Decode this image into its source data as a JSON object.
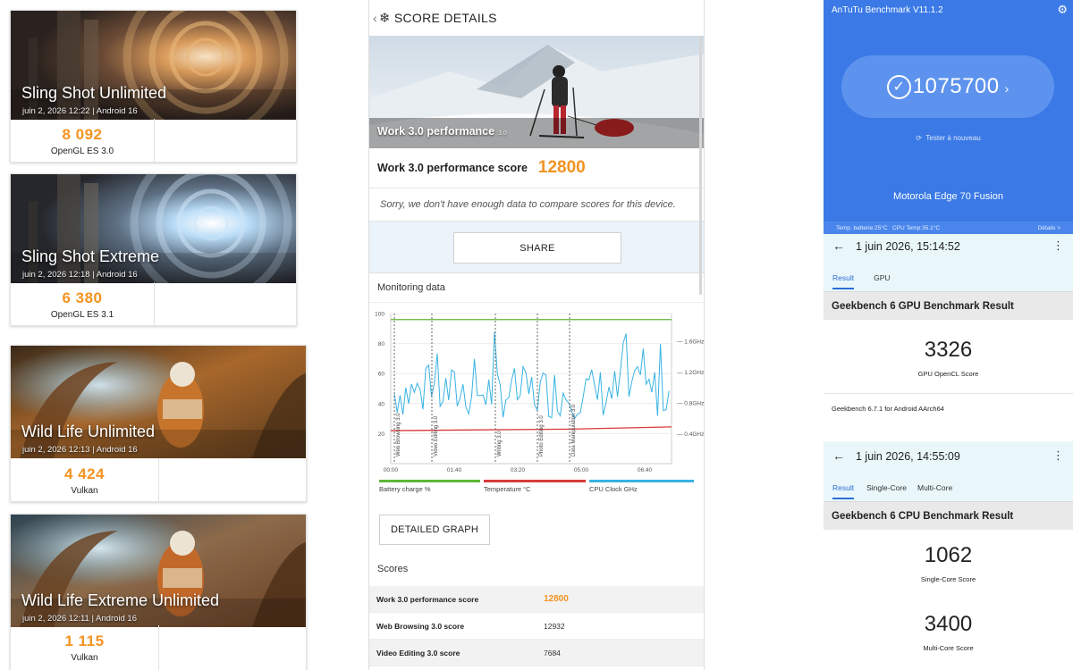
{
  "threedmark": {
    "cards": [
      {
        "title": "Sling Shot Unlimited",
        "subtitle": "juin 2, 2026 12:22 | Android 16",
        "score": "8 092",
        "api": "OpenGL ES 3.0"
      },
      {
        "title": "Sling Shot Extreme",
        "subtitle": "juin 2, 2026 12:18 | Android 16",
        "score": "6 380",
        "api": "OpenGL ES 3.1"
      },
      {
        "title": "Wild Life Unlimited",
        "subtitle": "juin 2, 2026 12:13 | Android 16",
        "score": "4 424",
        "api": "Vulkan"
      },
      {
        "title": "Wild Life Extreme Unlimited",
        "subtitle": "juin 2, 2026 12:11 | Android 16",
        "score": "1 115",
        "api": "Vulkan"
      }
    ]
  },
  "pcmark": {
    "back_icon": "chevron-left-icon",
    "header": "SCORE DETAILS",
    "hero_title": "Work 3.0 performance",
    "hero_version": "3.0",
    "score_label": "Work 3.0 performance score",
    "score_value": "12800",
    "sorry_text": "Sorry, we don't have enough data to compare scores for this device.",
    "share_label": "SHARE",
    "monitoring_title": "Monitoring data",
    "detailed_graph_label": "DETAILED GRAPH",
    "scores_title": "Scores",
    "scores_rows": [
      {
        "label": "Work 3.0 performance score",
        "value": "12800"
      },
      {
        "label": "Web Browsing 3.0 score",
        "value": "12932"
      },
      {
        "label": "Video Editing 3.0 score",
        "value": "7684"
      }
    ],
    "chart_data": {
      "type": "line",
      "x_ticks": [
        "00:00",
        "01:40",
        "03:20",
        "05:00",
        "06:40"
      ],
      "y_left_ticks": [
        "20",
        "40",
        "60",
        "80",
        "100"
      ],
      "y_right_ticks": [
        "0.4GHz",
        "0.8GHz",
        "1.2GHz",
        "1.6GHz"
      ],
      "ylim": [
        0,
        100
      ],
      "markers": [
        "Web Browsing 3.0",
        "Video Editing 3.0",
        "Writing 3.0",
        "Photo Editing 3.0",
        "Data Manipulation 3.0"
      ],
      "series": [
        {
          "name": "Battery charge %",
          "color": "#5fb636"
        },
        {
          "name": "Temperature °C",
          "color": "#d93a3a"
        },
        {
          "name": "CPU Clock GHz",
          "color": "#38b3e3"
        }
      ]
    }
  },
  "antutu": {
    "title": "AnTuTu Benchmark V11.1.2",
    "score": "1075700",
    "retest": "Tester à nouveau",
    "device": "Motorola Edge 70 Fusion",
    "battery_temp": "Temp. batterie:25°C",
    "cpu_temp": "CPU Temp:35.1°C",
    "details": "Détails >"
  },
  "geekbench_gpu": {
    "date": "1 juin 2026, 15:14:52",
    "tabs": [
      "Result",
      "GPU"
    ],
    "title": "Geekbench 6 GPU Benchmark Result",
    "score": "3326",
    "score_label": "GPU OpenCL Score",
    "version": "Geekbench 6.7.1 for Android AArch64"
  },
  "geekbench_cpu": {
    "date": "1 juin 2026, 14:55:09",
    "tabs": [
      "Result",
      "Single-Core",
      "Multi-Core"
    ],
    "title": "Geekbench 6 CPU Benchmark Result",
    "single": "1062",
    "single_label": "Single-Core Score",
    "multi": "3400",
    "multi_label": "Multi-Core Score"
  }
}
